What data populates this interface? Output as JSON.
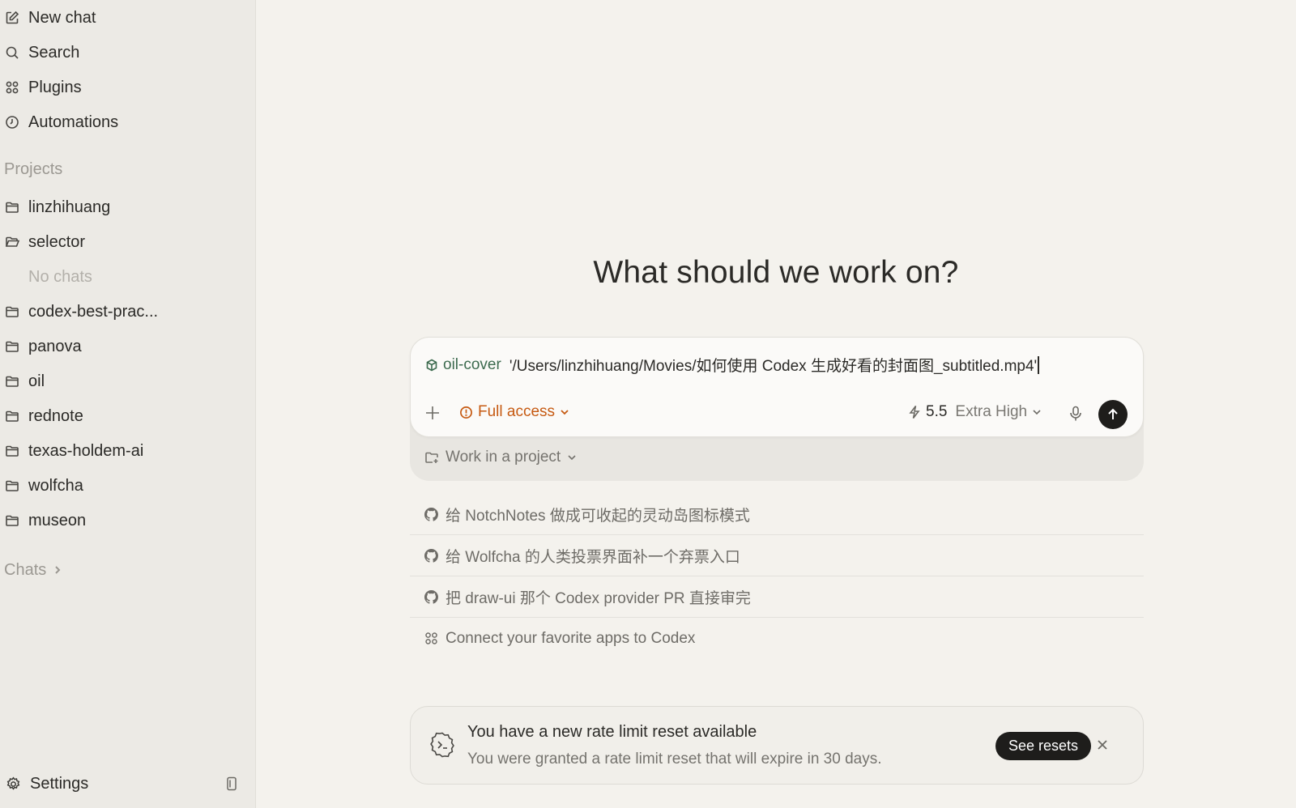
{
  "sidebar": {
    "top_items": [
      {
        "label": "New chat",
        "icon": "compose-icon"
      },
      {
        "label": "Search",
        "icon": "search-icon"
      },
      {
        "label": "Plugins",
        "icon": "grid-icon"
      },
      {
        "label": "Automations",
        "icon": "clock-icon"
      }
    ],
    "projects_title": "Projects",
    "projects": [
      {
        "label": "linzhihuang"
      },
      {
        "label": "selector"
      },
      {
        "label": "codex-best-prac..."
      },
      {
        "label": "panova"
      },
      {
        "label": "oil"
      },
      {
        "label": "rednote"
      },
      {
        "label": "texas-holdem-ai"
      },
      {
        "label": "wolfcha"
      },
      {
        "label": "museon"
      }
    ],
    "no_chats_label": "No chats",
    "chats_title": "Chats",
    "settings_label": "Settings"
  },
  "main": {
    "headline": "What should we work on?",
    "composer": {
      "project_chip": "oil-cover",
      "input_text": "'/Users/linzhihuang/Movies/如何使用 Codex 生成好看的封面图_subtitled.mp4'",
      "access_label": "Full access",
      "model_version": "5.5",
      "model_effort": "Extra High"
    },
    "project_row_label": "Work in a project",
    "suggestions": [
      {
        "label": "给 NotchNotes 做成可收起的灵动岛图标模式",
        "icon": "github-icon"
      },
      {
        "label": "给 Wolfcha 的人类投票界面补一个弃票入口",
        "icon": "github-icon"
      },
      {
        "label": "把 draw-ui 那个 Codex provider PR 直接审完",
        "icon": "github-icon"
      },
      {
        "label": "Connect your favorite apps to Codex",
        "icon": "apps-icon"
      }
    ],
    "banner": {
      "title": "You have a new rate limit reset available",
      "text": "You were granted a rate limit reset that will expire in 30 days.",
      "button": "See resets"
    }
  },
  "colors": {
    "accent_orange": "#c65a12",
    "project_green": "#3d6b4f",
    "background": "#f4f2ed",
    "sidebar": "#eceae5"
  }
}
